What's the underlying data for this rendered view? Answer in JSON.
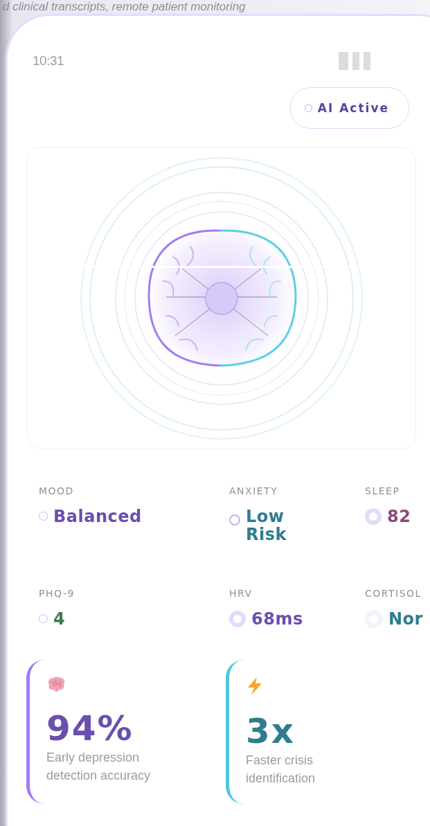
{
  "backdrop_text": "d clinical transcripts, remote patient monitoring",
  "status_bar": {
    "time": "10:31"
  },
  "ai_badge": {
    "label": "AI Active"
  },
  "metrics": [
    {
      "label": "MOOD",
      "value": "Balanced",
      "color": "#6a4fad"
    },
    {
      "label": "ANXIETY",
      "value": "Low Risk",
      "color": "#2f7d8f"
    },
    {
      "label": "SLEEP",
      "value": "82",
      "color": "#8a4a7a"
    },
    {
      "label": "PHQ-9",
      "value": "4",
      "color": "#3f7a55"
    },
    {
      "label": "HRV",
      "value": "68ms",
      "color": "#6a4fad"
    },
    {
      "label": "CORTISOL",
      "value": "Nor",
      "color": "#2f7d8f"
    }
  ],
  "stats": [
    {
      "kind": "brain",
      "value": "94%",
      "caption": "Early depression detection accuracy",
      "color": "#a07cf5"
    },
    {
      "kind": "bolt",
      "value": "3x",
      "caption": "Faster crisis identification",
      "color": "#4fc6e0"
    }
  ]
}
